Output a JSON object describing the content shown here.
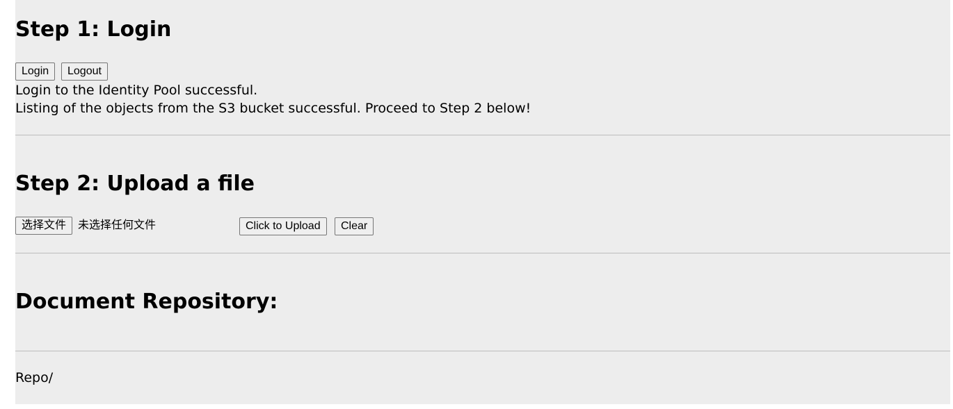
{
  "step1": {
    "title": "Step 1: Login",
    "login_label": "Login",
    "logout_label": "Logout",
    "status_lines": [
      "Login to the Identity Pool successful.",
      "Listing of the objects from the S3 bucket successful. Proceed to Step 2 below!"
    ]
  },
  "step2": {
    "title": "Step 2: Upload a file",
    "choose_file_label": "选择文件",
    "no_file_text": "未选择任何文件",
    "upload_label": "Click to Upload",
    "clear_label": "Clear"
  },
  "repository": {
    "title": "Document Repository:",
    "path": "Repo/"
  }
}
